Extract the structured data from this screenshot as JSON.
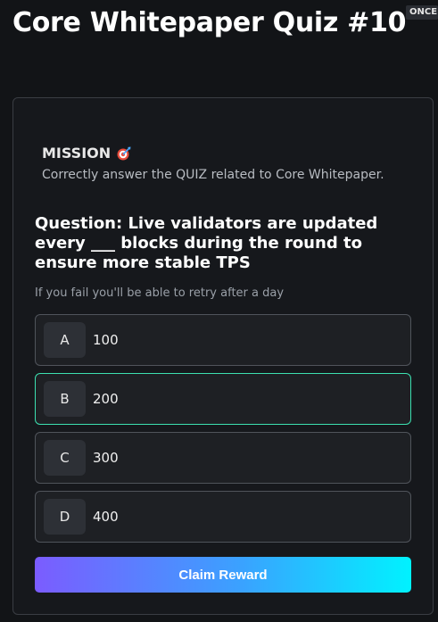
{
  "header": {
    "title": "Core Whitepaper Quiz #10",
    "badge": "ONCE"
  },
  "mission": {
    "title": "MISSION",
    "icon": "target-icon",
    "description": "Correctly answer the QUIZ related to Core Whitepaper."
  },
  "quiz": {
    "question": "Question: Live validators are updated every ___ blocks during the round to ensure more stable TPS",
    "hint": "If you fail you'll be able to retry after a day",
    "selected": "B",
    "options": [
      {
        "letter": "A",
        "text": "100"
      },
      {
        "letter": "B",
        "text": "200"
      },
      {
        "letter": "C",
        "text": "300"
      },
      {
        "letter": "D",
        "text": "400"
      }
    ]
  },
  "actions": {
    "claim_label": "Claim Reward"
  },
  "colors": {
    "background": "#121417",
    "selected_border": "#3ce0b0",
    "gradient_start": "#7b5cff",
    "gradient_end": "#00f2ff"
  }
}
